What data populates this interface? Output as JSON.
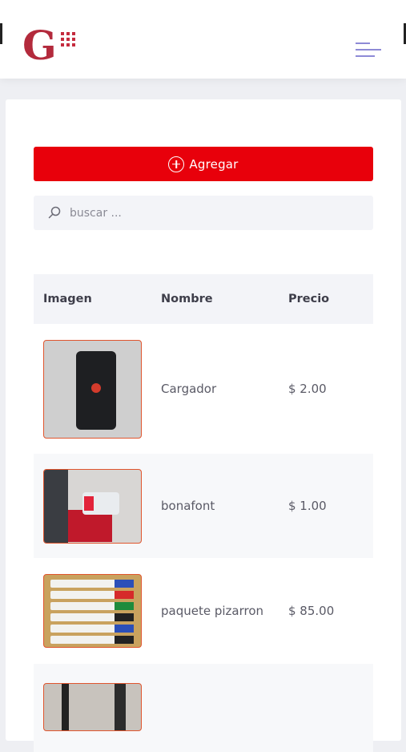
{
  "header": {
    "logo_letter": "G",
    "logo_color": "#b32a3c",
    "menu_icon": "hamburger-menu-icon"
  },
  "actions": {
    "add_label": "Agregar",
    "add_icon": "plus-circle-icon",
    "accent_color": "#e8000b"
  },
  "search": {
    "placeholder": "buscar ...",
    "icon": "search-icon"
  },
  "table": {
    "headers": {
      "image": "Imagen",
      "name": "Nombre",
      "price": "Precio"
    },
    "rows": [
      {
        "name": "Cargador",
        "price": "$ 2.00"
      },
      {
        "name": "bonafont",
        "price": "$ 1.00"
      },
      {
        "name": "paquete pizarron",
        "price": "$ 85.00"
      },
      {
        "name": "",
        "price": ""
      }
    ]
  }
}
